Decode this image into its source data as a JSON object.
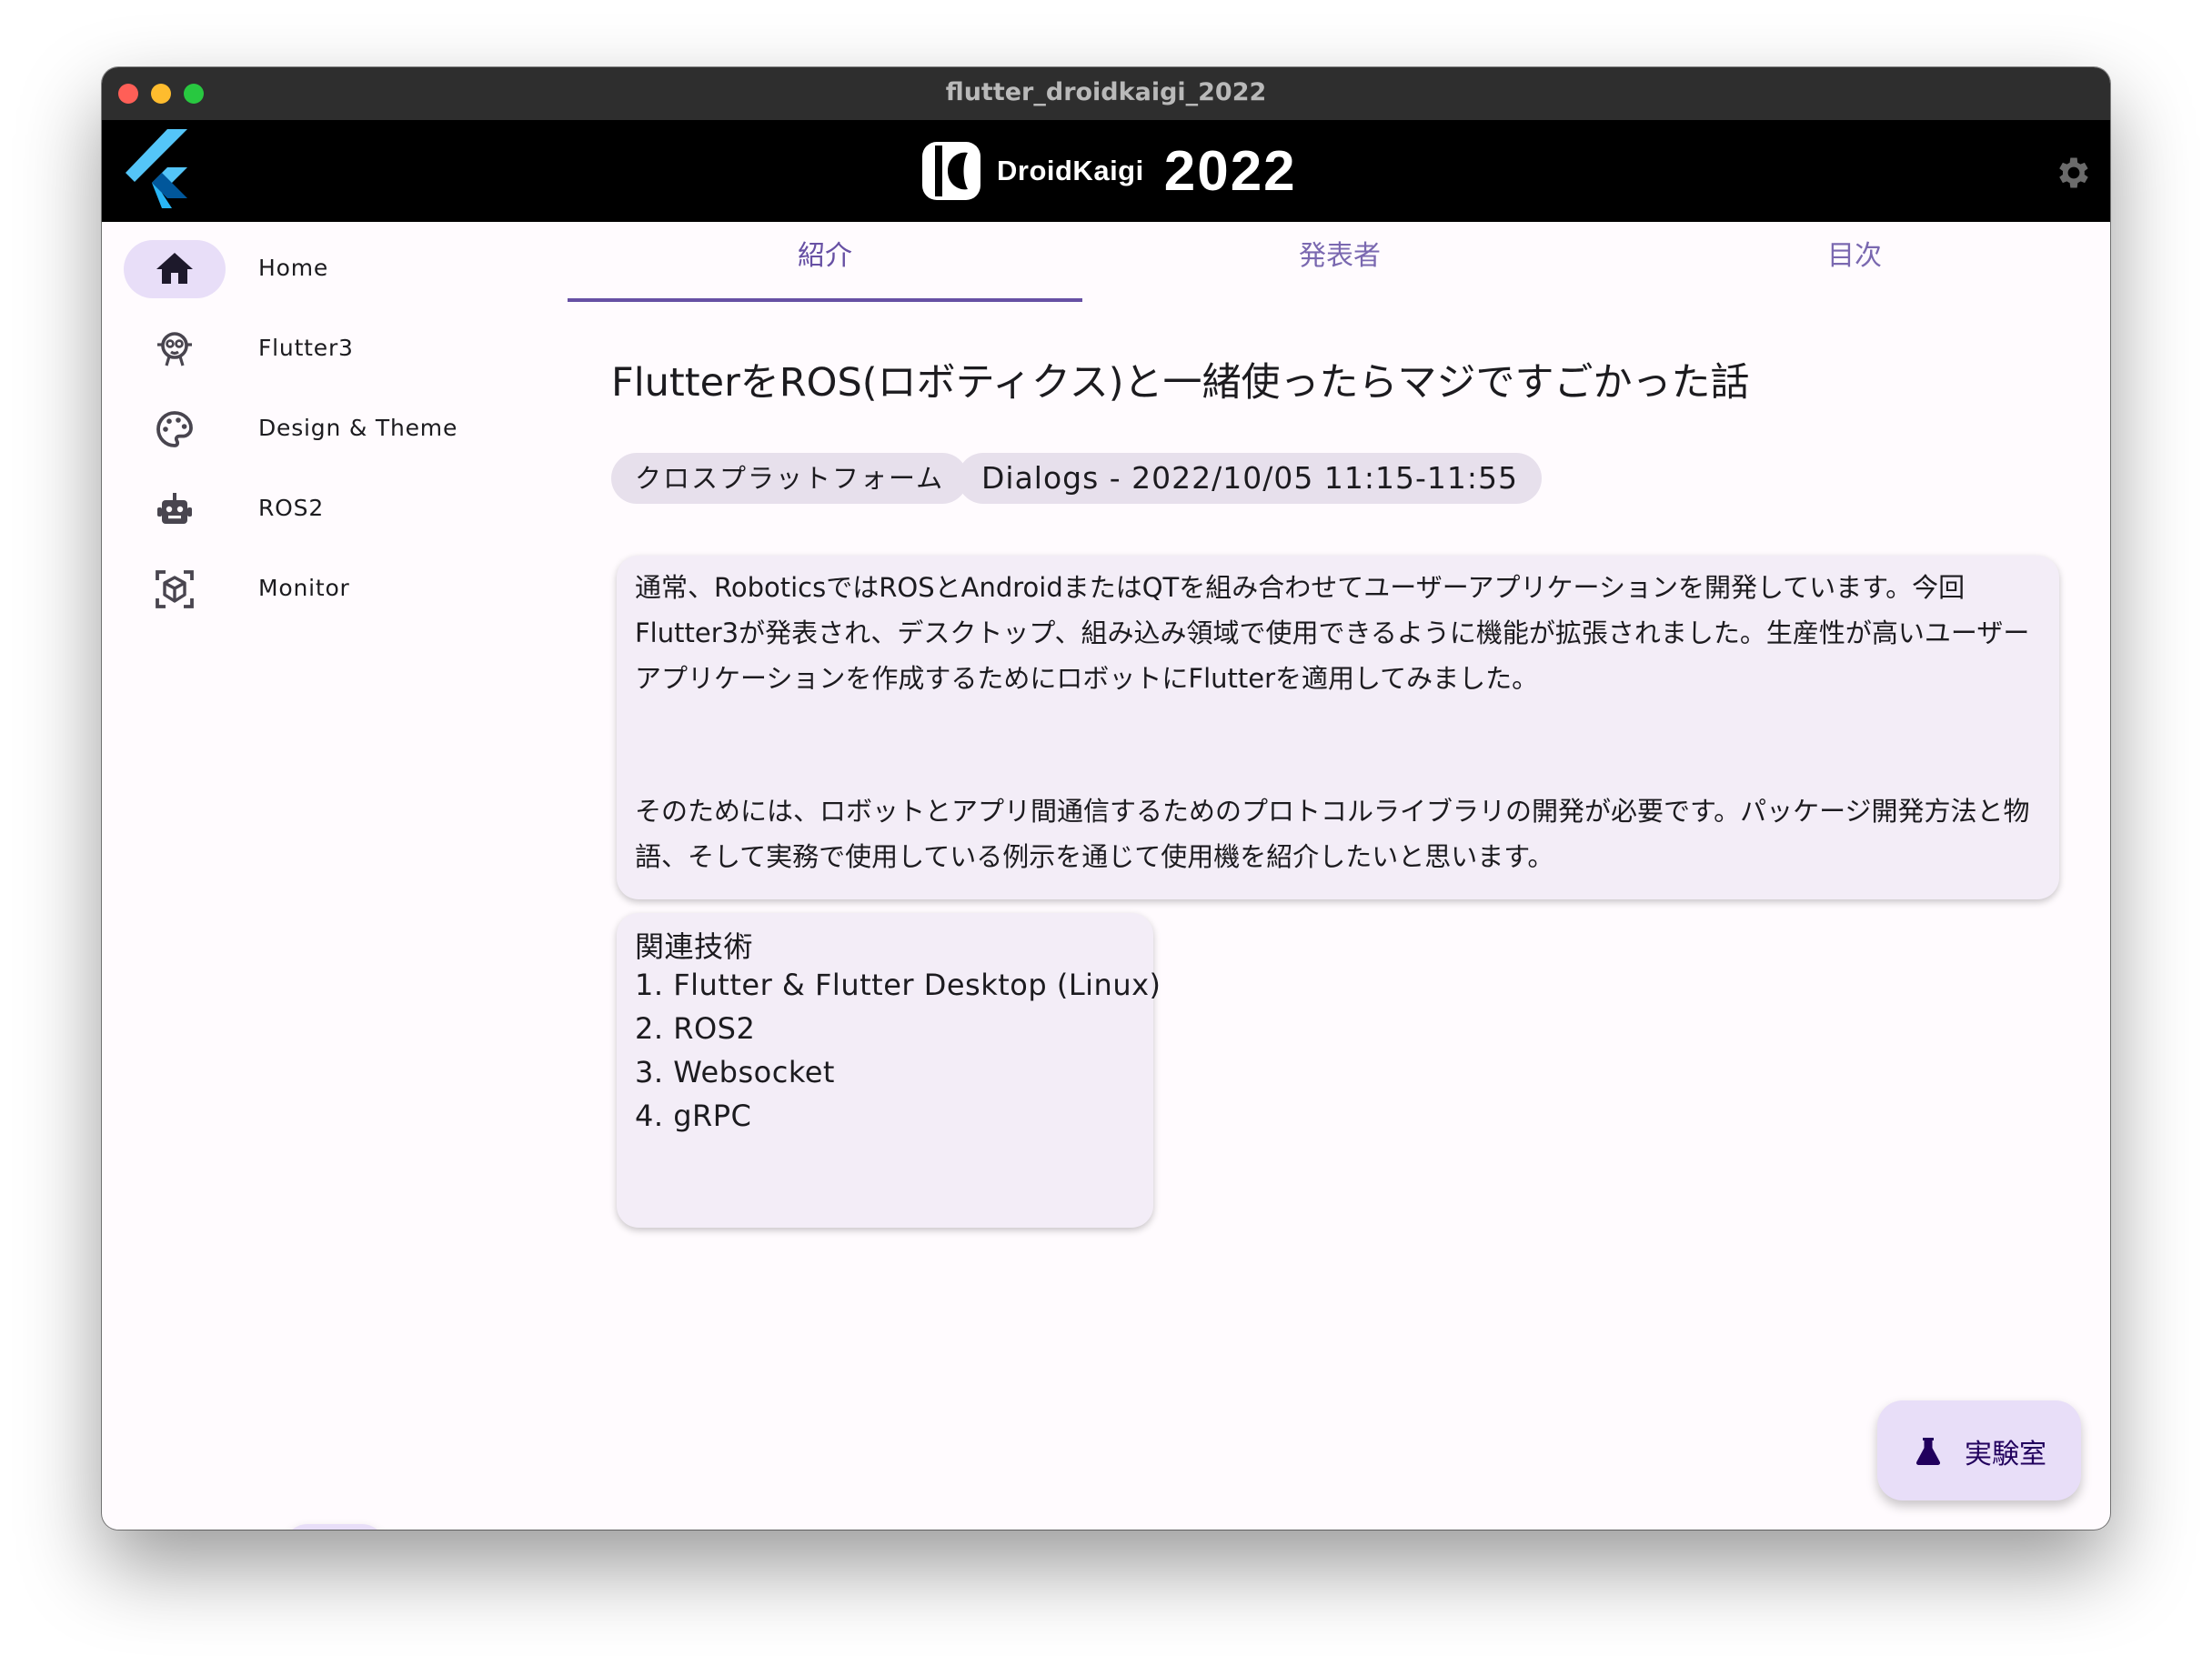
{
  "window": {
    "title": "flutter_droidkaigi_2022"
  },
  "appbar": {
    "brand_name": "DroidKaigi",
    "brand_year": "2022"
  },
  "sidebar": {
    "items": [
      {
        "label": "Home",
        "icon": "home-icon",
        "active": true
      },
      {
        "label": "Flutter3",
        "icon": "flutter3-icon",
        "active": false
      },
      {
        "label": "Design & Theme",
        "icon": "palette-icon",
        "active": false
      },
      {
        "label": "ROS2",
        "icon": "robot-icon",
        "active": false
      },
      {
        "label": "Monitor",
        "icon": "monitor-icon",
        "active": false
      }
    ]
  },
  "tabs": [
    {
      "label": "紹介",
      "selected": true
    },
    {
      "label": "発表者",
      "selected": false
    },
    {
      "label": "目次",
      "selected": false
    }
  ],
  "session": {
    "title": "FlutterをROS(ロボティクス)と一緒使ったらマジですごかった話",
    "category": "クロスプラットフォーム",
    "schedule": "Dialogs ‐ 2022/10/05 11:15-11:55",
    "description_p1": "通常、RoboticsではROSとAndroidまたはQTを組み合わせてユーザーアプリケーションを開発しています。今回Flutter3が発表され、デスクトップ、組み込み領域で使用できるように機能が拡張されました。生産性が高いユーザーアプリケーションを作成するためにロボットにFlutterを適用してみました。",
    "description_p2": "そのためには、ロボットとアプリ間通信するためのプロトコルライブラリの開発が必要です。パッケージ開発方法と物語、そして実務で使用している例示を通じて使用機を紹介したいと思います。",
    "related_title": "関連技術",
    "related": [
      "1. Flutter & Flutter Desktop (Linux)",
      "2. ROS2",
      "3. Websocket",
      "4. gRPC"
    ]
  },
  "fab": {
    "lab_label": "実験室"
  },
  "colors": {
    "primary": "#6750a4",
    "secondary_container": "#e8def8",
    "surface": "#fffbfe",
    "chip": "#e7e0ec",
    "card": "#f3edf7"
  }
}
